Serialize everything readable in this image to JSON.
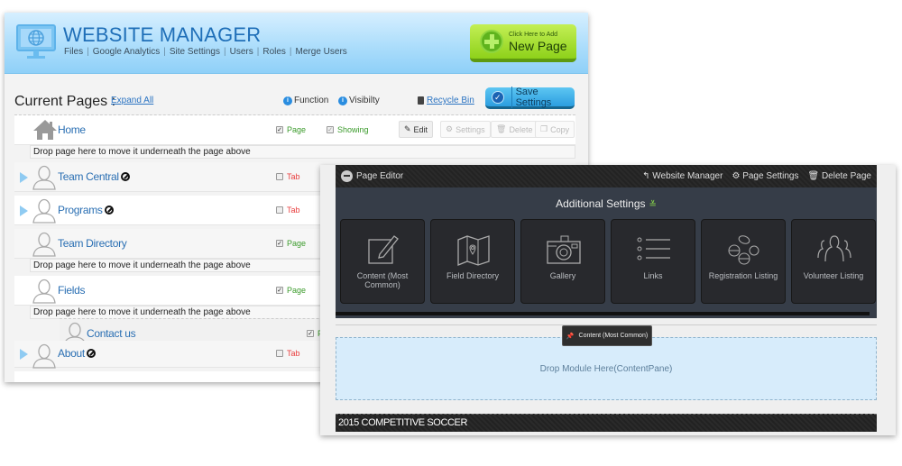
{
  "website_manager": {
    "title": "WEBSITE MANAGER",
    "nav_links": [
      "Files",
      "Google Analytics",
      "Site Settings",
      "Users",
      "Roles",
      "Merge Users"
    ],
    "new_page_button": {
      "small": "Click Here to Add",
      "big": "New Page"
    },
    "toolbar": {
      "title": "Current Pages :",
      "expand_all": "Expand All",
      "function": "Function",
      "visibility": "Visibilty",
      "recycle_bin": "Recycle Bin",
      "save_settings": "Save Settings"
    },
    "drop_text": "Drop page here to move it underneath the page above",
    "actions": [
      "Edit",
      "Settings",
      "Delete",
      "Copy"
    ],
    "pages": [
      {
        "name": "Home",
        "type_label": "Page",
        "type_checked": true,
        "visibility_label": "Showing",
        "hidden": false
      },
      {
        "name": "Team Central",
        "type_label": "Tab",
        "type_checked": false,
        "hidden": true,
        "expandable": true
      },
      {
        "name": "Programs",
        "type_label": "Tab",
        "type_checked": false,
        "hidden": true,
        "expandable": true
      },
      {
        "name": "Team Directory",
        "type_label": "Page",
        "type_checked": true,
        "hidden": false
      },
      {
        "name": "Fields",
        "type_label": "Page",
        "type_checked": true,
        "hidden": false
      },
      {
        "name": "Contact us",
        "type_label": "P",
        "type_checked": true,
        "hidden": false,
        "child": true
      },
      {
        "name": "About",
        "type_label": "Tab",
        "type_checked": false,
        "hidden": true,
        "expandable": true
      }
    ]
  },
  "page_editor": {
    "title": "Page Editor",
    "header_actions": [
      "Website Manager",
      "Page Settings",
      "Delete Page"
    ],
    "additional_settings": "Additional Settings",
    "modules": [
      {
        "label": "Content (Most Common)",
        "icon": "edit-icon"
      },
      {
        "label": "Field Directory",
        "icon": "map-icon"
      },
      {
        "label": "Gallery",
        "icon": "camera-icon"
      },
      {
        "label": "Links",
        "icon": "list-icon"
      },
      {
        "label": "Registration Listing",
        "icon": "sports-balls-icon"
      },
      {
        "label": "Volunteer Listing",
        "icon": "people-icon"
      }
    ],
    "drag_tooltip": "Content (Most Common)",
    "drop_zone": "Drop Module Here(ContentPane)",
    "section_title": "2015 COMPETITIVE SOCCER"
  },
  "colors": {
    "header_blue": "#a9dcfb",
    "title_blue": "#1f6fb8",
    "new_page_green": "#8ed11a",
    "save_blue": "#2c9ee0",
    "page_link": "#2a6fb3",
    "page_green": "#3a9a2a",
    "tab_red": "#e94040",
    "editor_dark": "#363d48",
    "drop_zone": "#d7ecfb"
  }
}
